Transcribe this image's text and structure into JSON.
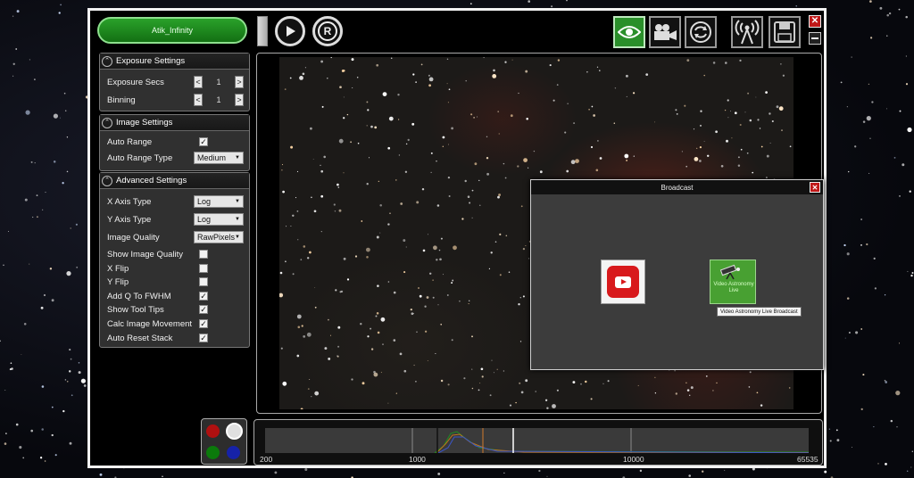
{
  "camera": {
    "name": "Atik_Infinity"
  },
  "toolbar": {
    "play": "play-icon",
    "record": "R",
    "view": "eye-icon",
    "video": "video-camera-icon",
    "refresh": "refresh-icon",
    "broadcast": "broadcast-antenna-icon",
    "save": "save-disk-icon",
    "close": "✕"
  },
  "exposure": {
    "title": "Exposure Settings",
    "exposure_label": "Exposure Secs",
    "exposure_value": "1",
    "binning_label": "Binning",
    "binning_value": "1",
    "dec": "<",
    "inc": ">"
  },
  "image_settings": {
    "title": "Image Settings",
    "auto_range_label": "Auto Range",
    "auto_range_checked": true,
    "auto_range_type_label": "Auto Range Type",
    "auto_range_type_value": "Medium"
  },
  "advanced": {
    "title": "Advanced Settings",
    "x_axis_label": "X Axis Type",
    "x_axis_value": "Log",
    "y_axis_label": "Y Axis Type",
    "y_axis_value": "Log",
    "quality_label": "Image Quality",
    "quality_value": "RawPixels",
    "checks": [
      {
        "label": "Show Image Quality",
        "checked": false
      },
      {
        "label": "X Flip",
        "checked": false
      },
      {
        "label": "Y Flip",
        "checked": false
      },
      {
        "label": "Add Q To FWHM",
        "checked": true
      },
      {
        "label": "Show Tool Tips",
        "checked": true
      },
      {
        "label": "Calc Image Movement",
        "checked": true
      },
      {
        "label": "Auto Reset Stack",
        "checked": true
      }
    ]
  },
  "dialog": {
    "title": "Broadcast",
    "close": "✕",
    "tile_text": "Video Astronomy Live",
    "tooltip": "Video Astronomy Live Broadcast"
  },
  "histogram": {
    "labels": [
      "200",
      "1000",
      "10000",
      "65535"
    ]
  },
  "colors": {
    "accent_green": "#2aa12a",
    "red_dot": "#b01010",
    "white_dot": "#e0e0e0",
    "green_dot": "#0b7a0b",
    "blue_dot": "#1622a8"
  }
}
